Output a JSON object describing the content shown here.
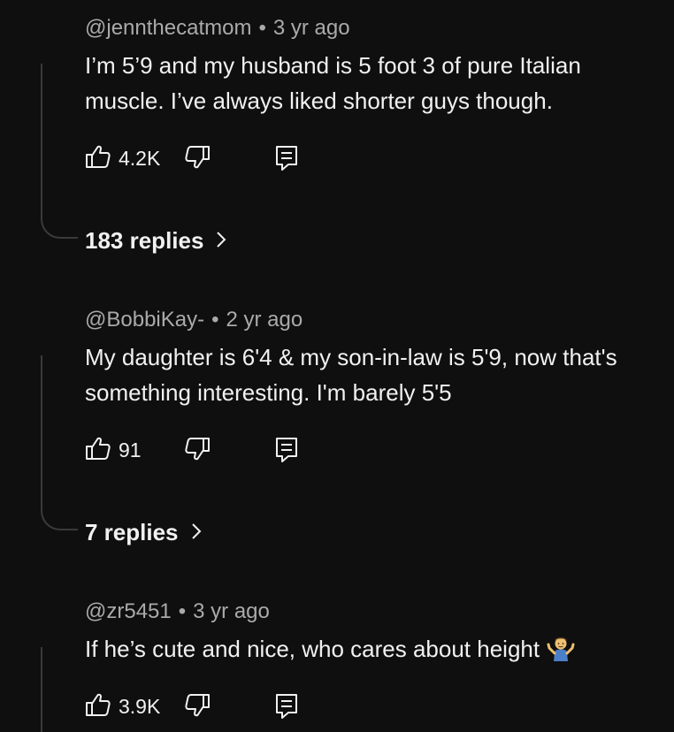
{
  "colors": {
    "background": "#0f0f0f",
    "text_primary": "#f1f1f1",
    "text_secondary": "#aaaaaa",
    "thread_line": "#3a3a3a"
  },
  "comments": [
    {
      "author": "@jennthecatmom",
      "separator": "•",
      "time": "3 yr ago",
      "text": "I’m 5’9 and my husband is 5 foot 3 of pure Italian muscle. I’ve always liked shorter guys though.",
      "likes": "4.2K",
      "replies_label": "183 replies",
      "icons": [
        "thumbs-up-icon",
        "thumbs-down-icon",
        "reply-icon",
        "chevron-right-icon"
      ]
    },
    {
      "author": "@BobbiKay-",
      "separator": "•",
      "time": "2 yr ago",
      "text": "My daughter is 6'4 & my son-in-law is 5'9, now that's something interesting. I'm barely 5'5",
      "likes": "91",
      "replies_label": "7 replies",
      "icons": [
        "thumbs-up-icon",
        "thumbs-down-icon",
        "reply-icon",
        "chevron-right-icon"
      ]
    },
    {
      "author": "@zr5451",
      "separator": "•",
      "time": "3 yr ago",
      "text": "If he’s cute and nice, who cares about height",
      "emoji": "shrug-emoji",
      "likes": "3.9K",
      "icons": [
        "thumbs-up-icon",
        "thumbs-down-icon",
        "reply-icon"
      ]
    }
  ]
}
